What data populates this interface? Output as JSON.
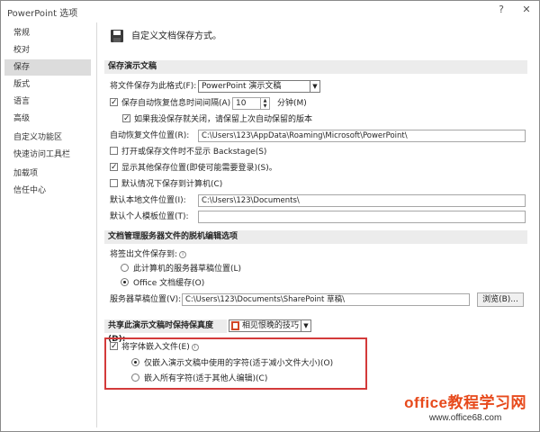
{
  "window": {
    "title": "PowerPoint 选项",
    "help_label": "?",
    "close_label": "✕"
  },
  "sidebar": {
    "items": [
      {
        "label": "常规"
      },
      {
        "label": "校对"
      },
      {
        "label": "保存",
        "active": true
      },
      {
        "label": "版式"
      },
      {
        "label": "语言"
      },
      {
        "label": "高级"
      },
      {
        "label": "自定义功能区"
      },
      {
        "label": "快速访问工具栏"
      },
      {
        "label": "加载项"
      },
      {
        "label": "信任中心"
      }
    ]
  },
  "header": {
    "title": "自定义文档保存方式。"
  },
  "save_section": {
    "title": "保存演示文稿",
    "format_label": "将文件保存为此格式(F):",
    "format_value": "PowerPoint 演示文稿",
    "autorecover_label": "保存自动恢复信息时间间隔(A)",
    "autorecover_value": "10",
    "minutes_label": "分钟(M)",
    "keep_last_label": "如果我没保存就关闭，请保留上次自动保留的版本",
    "autorecover_location_label": "自动恢复文件位置(R):",
    "autorecover_location_value": "C:\\Users\\123\\AppData\\Roaming\\Microsoft\\PowerPoint\\",
    "no_backstage_label": "打开或保存文件时不显示 Backstage(S)",
    "show_additional_label": "显示其他保存位置(即使可能需要登录)(S)。",
    "save_to_computer_label": "默认情况下保存到计算机(C)",
    "default_local_label": "默认本地文件位置(I):",
    "default_local_value": "C:\\Users\\123\\Documents\\",
    "personal_templates_label": "默认个人模板位置(T):",
    "personal_templates_value": ""
  },
  "offline_section": {
    "title": "文档管理服务器文件的脱机编辑选项",
    "checkout_label": "将签出文件保存到:",
    "server_drafts_label": "此计算机的服务器草稿位置(L)",
    "office_cache_label": "Office 文档缓存(O)",
    "drafts_location_label": "服务器草稿位置(V):",
    "drafts_location_value": "C:\\Users\\123\\Documents\\SharePoint 草稿\\",
    "browse_label": "浏览(B)..."
  },
  "fidelity_section": {
    "title": "共享此演示文稿时保持保真度(D):",
    "presentation_value": "相见恨晚的技巧",
    "embed_fonts_label": "将字体嵌入文件(E)",
    "embed_used_label": "仅嵌入演示文稿中使用的字符(适于减小文件大小)(O)",
    "embed_all_label": "嵌入所有字符(适于其他人编辑)(C)"
  },
  "watermark": {
    "main": "office教程学习网",
    "sub": "www.office68.com"
  },
  "colors": {
    "highlight": "#d33a3a",
    "watermark": "#e74a1c"
  }
}
